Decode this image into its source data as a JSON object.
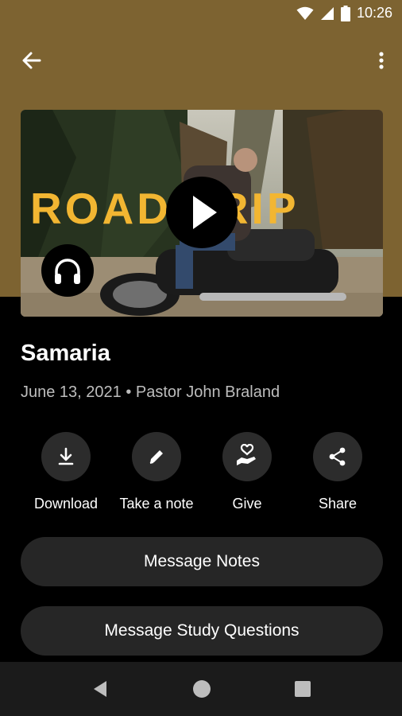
{
  "status_bar": {
    "time": "10:26"
  },
  "colors": {
    "header_bg": "#7d6331",
    "accent_text": "#f2b632",
    "page_bg": "#000000",
    "button_bg": "#262626"
  },
  "app_bar": {
    "back_icon": "arrow-left-icon",
    "menu_icon": "more-vert-icon"
  },
  "media": {
    "thumbnail_title": "ROAD TRIP",
    "play_icon": "play-icon",
    "audio_icon": "headphones-icon"
  },
  "sermon": {
    "title": "Samaria",
    "meta": "June 13, 2021 • Pastor John Braland"
  },
  "actions": [
    {
      "label": "Download",
      "icon": "download-icon"
    },
    {
      "label": "Take a note",
      "icon": "pencil-icon"
    },
    {
      "label": "Give",
      "icon": "give-hand-heart-icon"
    },
    {
      "label": "Share",
      "icon": "share-icon"
    }
  ],
  "buttons": {
    "notes": "Message Notes",
    "study": "Message Study Questions"
  },
  "nav": {
    "back": "nav-back-icon",
    "home": "nav-home-icon",
    "recents": "nav-recents-icon"
  }
}
